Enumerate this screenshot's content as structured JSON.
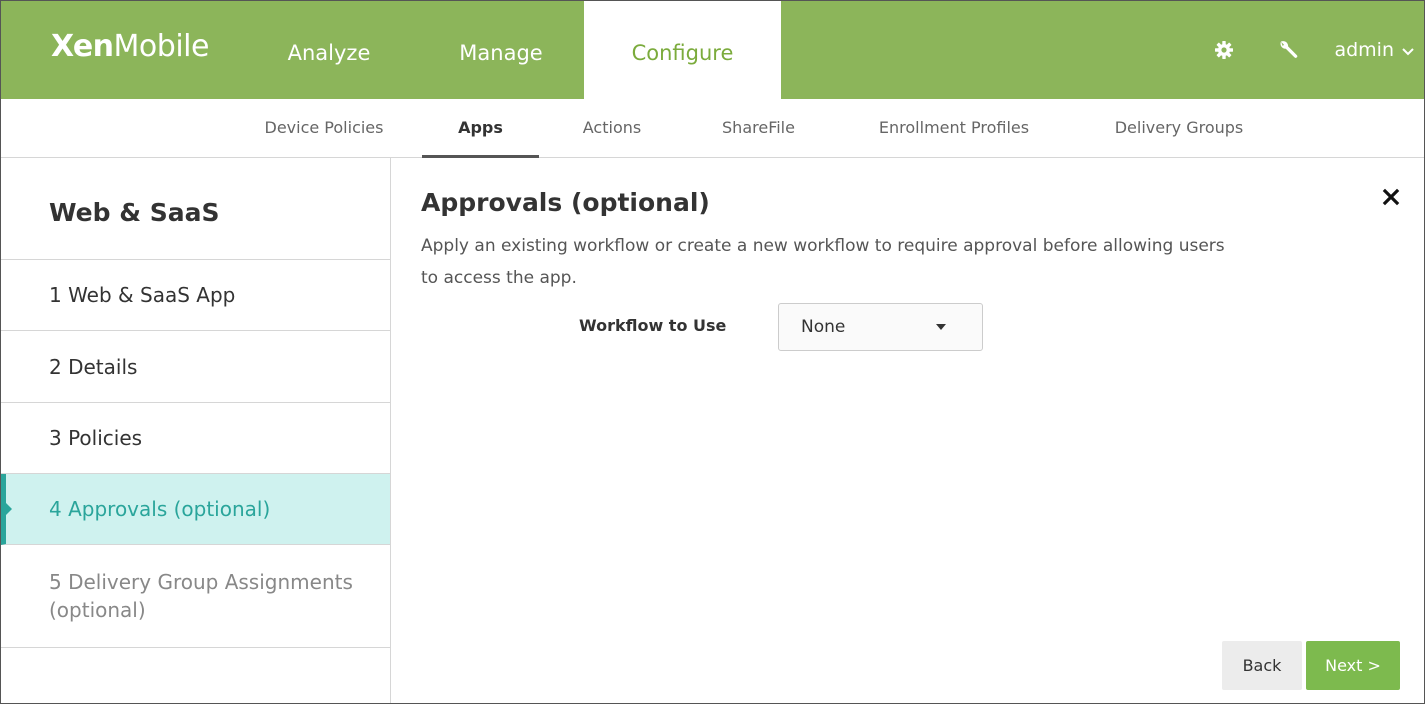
{
  "app": {
    "brand_bold": "Xen",
    "brand_light": "Mobile"
  },
  "topnav": {
    "items": [
      {
        "label": "Analyze"
      },
      {
        "label": "Manage"
      },
      {
        "label": "Configure",
        "active": true
      }
    ],
    "user": "admin"
  },
  "subnav": {
    "items": [
      {
        "label": "Device Policies"
      },
      {
        "label": "Apps",
        "active": true
      },
      {
        "label": "Actions"
      },
      {
        "label": "ShareFile"
      },
      {
        "label": "Enrollment Profiles"
      },
      {
        "label": "Delivery Groups"
      }
    ]
  },
  "sidebar": {
    "title": "Web & SaaS",
    "steps": [
      {
        "label": "1  Web & SaaS App"
      },
      {
        "label": "2  Details"
      },
      {
        "label": "3  Policies"
      },
      {
        "label": "4  Approvals (optional)",
        "active": true
      },
      {
        "label": "5  Delivery Group Assignments (optional)"
      }
    ]
  },
  "main": {
    "heading": "Approvals (optional)",
    "description_line1": "Apply an existing workflow or create a new workflow to require approval before allowing users",
    "description_line2": "to access the app.",
    "workflow_label": "Workflow to Use",
    "workflow_value": "None",
    "back_label": "Back",
    "next_label": "Next >"
  },
  "colors": {
    "topbar": "#8cb55a",
    "configure_text": "#7bab3c",
    "active_step_bg": "#cff2ef",
    "active_step_text": "#2aa59b",
    "next_button": "#7dba4e"
  },
  "icons": {
    "settings": "gear-icon",
    "tools": "wrench-icon",
    "user_menu": "chevron-down-icon",
    "close": "close-icon",
    "select": "caret-down-icon"
  }
}
